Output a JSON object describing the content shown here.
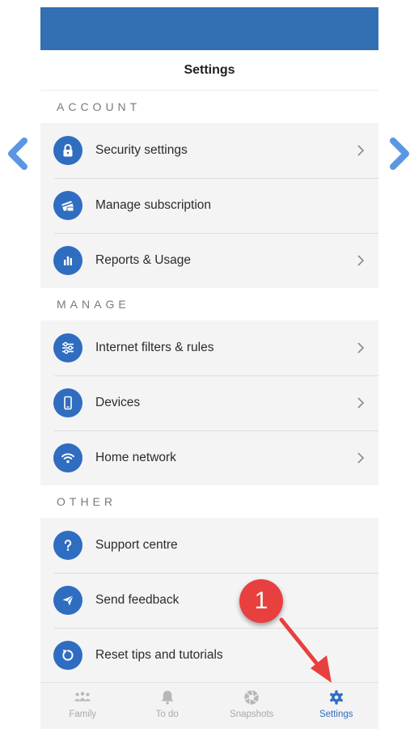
{
  "page": {
    "title": "Settings"
  },
  "colors": {
    "status_bar": "#336fb3",
    "accent": "#2f6dc0",
    "callout": "#e8403f"
  },
  "sections": [
    {
      "header": "ACCOUNT",
      "items": [
        {
          "label": "Security settings",
          "icon": "lock-icon",
          "chevron": true
        },
        {
          "label": "Manage subscription",
          "icon": "credit-card-icon",
          "chevron": false
        },
        {
          "label": "Reports & Usage",
          "icon": "bar-chart-icon",
          "chevron": true
        }
      ]
    },
    {
      "header": "MANAGE",
      "items": [
        {
          "label": "Internet filters & rules",
          "icon": "sliders-icon",
          "chevron": true
        },
        {
          "label": "Devices",
          "icon": "phone-icon",
          "chevron": true
        },
        {
          "label": "Home network",
          "icon": "wifi-icon",
          "chevron": true
        }
      ]
    },
    {
      "header": "OTHER",
      "items": [
        {
          "label": "Support centre",
          "icon": "question-icon",
          "chevron": false
        },
        {
          "label": "Send feedback",
          "icon": "send-icon",
          "chevron": false
        },
        {
          "label": "Reset tips and tutorials",
          "icon": "reset-icon",
          "chevron": false
        }
      ]
    }
  ],
  "tabs": [
    {
      "label": "Family",
      "icon": "family-icon",
      "active": false
    },
    {
      "label": "To do",
      "icon": "bell-icon",
      "active": false
    },
    {
      "label": "Snapshots",
      "icon": "aperture-icon",
      "active": false
    },
    {
      "label": "Settings",
      "icon": "gear-icon",
      "active": true
    }
  ],
  "callout": {
    "number": "1"
  }
}
